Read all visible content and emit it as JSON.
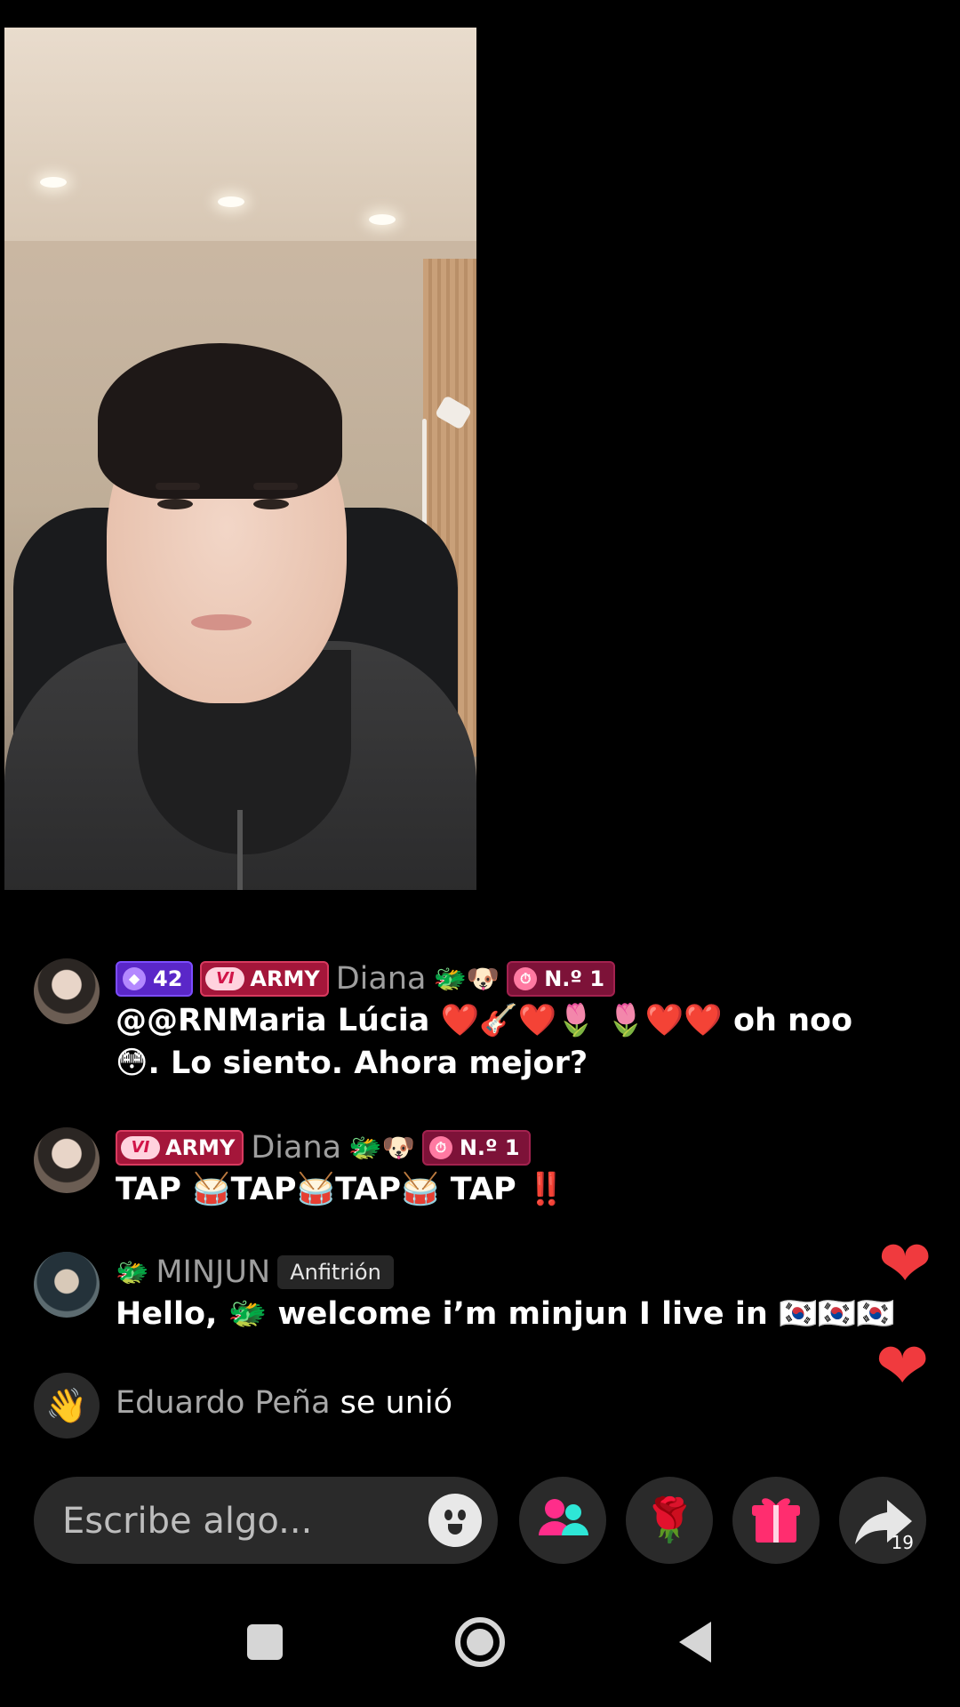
{
  "messages": [
    {
      "level": "42",
      "fan_badge": "ARMY",
      "fan_prefix": "VI",
      "username": "Diana",
      "username_emojis": "🐲🐶",
      "rank": "N.º 1",
      "text_line1": "@@RNMaria Lúcia ❤️🎸❤️🌷 🌷❤️❤️ oh noo",
      "text_line2": "😳. Lo siento. Ahora mejor?"
    },
    {
      "fan_badge": "ARMY",
      "fan_prefix": "VI",
      "username": "Diana",
      "username_emojis": "🐲🐶",
      "rank": "N.º 1",
      "text": "TAP 🥁TAP🥁TAP🥁 TAP ‼️"
    },
    {
      "username_emoji": "🐲",
      "username": "MINJUN",
      "host_tag": "Anfitrión",
      "text": "Hello, 🐲 welcome i’m minjun I live in 🇰🇷🇰🇷🇰🇷"
    }
  ],
  "join": {
    "username": "Eduardo Peña",
    "action": "se unió"
  },
  "comment_input": {
    "placeholder": "Escribe algo..."
  },
  "actions": {
    "share_count": "19",
    "icons": [
      "smile-emoji-icon",
      "guests-icon",
      "rose-gift-icon",
      "gift-box-icon",
      "share-arrow-icon"
    ]
  },
  "colors": {
    "heart": "#f03a3e",
    "gift": "#ff2d6f",
    "guests": "#ff2d8a",
    "level_badge": "#5a27c8",
    "fan_badge": "#a4163a"
  }
}
